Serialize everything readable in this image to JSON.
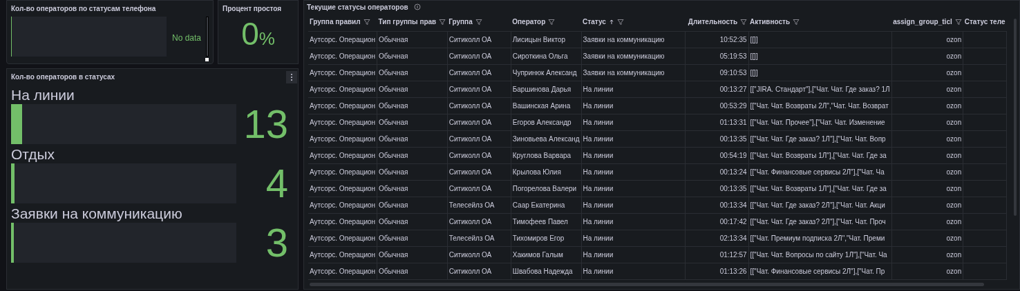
{
  "phone_panel": {
    "title": "Кол-во операторов по статусам телефона",
    "message": "No data"
  },
  "idle_panel": {
    "title": "Процент простоя",
    "value": "0",
    "unit": "%"
  },
  "status_panel": {
    "title": "Кол-во операторов в статусах",
    "gauges": [
      {
        "label": "На линии",
        "value": "13",
        "level": 0.05
      },
      {
        "label": "Отдых",
        "value": "4",
        "level": 0.015
      },
      {
        "label": "Заявки на коммуникацию",
        "value": "3",
        "level": 0.012
      }
    ]
  },
  "table_panel": {
    "title": "Текущие статусы операторов",
    "table": {
      "columns": [
        {
          "label": "Группа правил",
          "sorted": false
        },
        {
          "label": "Тип группы прав",
          "sorted": false
        },
        {
          "label": "Группа",
          "sorted": false
        },
        {
          "label": "Оператор",
          "sorted": false
        },
        {
          "label": "Статус",
          "sorted": true
        },
        {
          "label": "Длительность",
          "sorted": false
        },
        {
          "label": "Активность",
          "sorted": false
        },
        {
          "label": "assign_group_ticl",
          "sorted": false
        },
        {
          "label": "Статус теле",
          "sorted": false
        }
      ],
      "rows": [
        [
          "Аутсорс. Операцион",
          "Обычная",
          "Ситиколл ОА",
          "Лисицын Виктор",
          "Заявки на коммуникацию",
          "10:52:35",
          "[[]]",
          "ozon"
        ],
        [
          "Аутсорс. Операцион",
          "Обычная",
          "Ситиколл ОА",
          "Сироткина Ольга",
          "Заявки на коммуникацию",
          "05:19:53",
          "[[]]",
          "ozon"
        ],
        [
          "Аутсорс. Операцион",
          "Обычная",
          "Ситиколл ОА",
          "Чупринюк Александ",
          "Заявки на коммуникацию",
          "09:10:53",
          "[[]]",
          "ozon"
        ],
        [
          "Аутсорс. Операцион",
          "Обычная",
          "Ситиколл ОА",
          "Баршинова Дарья",
          "На линии",
          "00:13:27",
          "[[\"JIRA. Стандарт\"],[\"Чат. Чат. Где заказ? 1Л",
          "ozon"
        ],
        [
          "Аутсорс. Операцион",
          "Обычная",
          "Ситиколл ОА",
          "Вашинская Арина",
          "На линии",
          "00:53:29",
          "[[\"Чат. Чат. Возвраты 2Л\",\"Чат. Чат. Возврат",
          "ozon"
        ],
        [
          "Аутсорс. Операцион",
          "Обычная",
          "Ситиколл ОА",
          "Егоров Александр",
          "На линии",
          "01:13:31",
          "[[\"Чат. Чат. Прочее\"],[\"Чат. Чат. Изменение",
          "ozon"
        ],
        [
          "Аутсорс. Операцион",
          "Обычная",
          "Ситиколл ОА",
          "Зиновьева Александ",
          "На линии",
          "00:13:35",
          "[[\"Чат. Чат. Где заказ? 1Л\"],[\"Чат. Чат. Вопр",
          "ozon"
        ],
        [
          "Аутсорс. Операцион",
          "Обычная",
          "Ситиколл ОА",
          "Круглова Варвара",
          "На линии",
          "00:54:19",
          "[[\"Чат. Чат. Возвраты 1Л\"],[\"Чат. Чат. Где за",
          "ozon"
        ],
        [
          "Аутсорс. Операцион",
          "Обычная",
          "Ситиколл ОА",
          "Крылова Юлия",
          "На линии",
          "00:13:24",
          "[[\"Чат. Финансовые сервисы 2Л\"],[\"Чат. Ча",
          "ozon"
        ],
        [
          "Аутсорс. Операцион",
          "Обычная",
          "Ситиколл ОА",
          "Погорелова Валери",
          "На линии",
          "00:13:35",
          "[[\"Чат. Чат. Возвраты 1Л\"],[\"Чат. Чат. Где за",
          "ozon"
        ],
        [
          "Аутсорс. Операцион",
          "Обычная",
          "Телесейлз ОА",
          "Саар Екатерина",
          "На линии",
          "00:13:34",
          "[[\"Чат. Чат. Где заказ? 2Л\"],[\"Чат. Чат. Акци",
          "ozon"
        ],
        [
          "Аутсорс. Операцион",
          "Обычная",
          "Ситиколл ОА",
          "Тимофеев Павел",
          "На линии",
          "00:17:42",
          "[[\"Чат. Чат. Где заказ? 2Л\"],[\"Чат. Чат. Проч",
          "ozon"
        ],
        [
          "Аутсорс. Операцион",
          "Обычная",
          "Телесейлз ОА",
          "Тихомиров Егор",
          "На линии",
          "02:13:34",
          "[[\"Чат. Премиум подписка 2Л\",\"Чат. Преми",
          "ozon"
        ],
        [
          "Аутсорс. Операцион",
          "Обычная",
          "Ситиколл ОА",
          "Хакимов Галым",
          "На линии",
          "01:12:57",
          "[[\"Чат. Чат. Вопросы по сайту 1Л\"],[\"Чат. Ча",
          "ozon"
        ],
        [
          "Аутсорс. Операцион",
          "Обычная",
          "Ситиколл ОА",
          "Швабова Надежда",
          "На линии",
          "01:13:26",
          "[[\"Чат. Финансовые сервисы 2Л\"],[\"Чат. Пр",
          "ozon"
        ]
      ]
    }
  }
}
